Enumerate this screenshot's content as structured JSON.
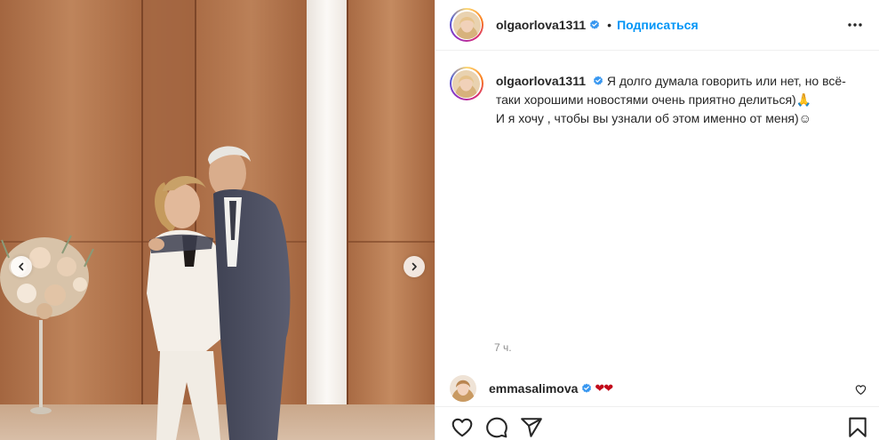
{
  "post": {
    "author": {
      "username": "olgaorlova1311",
      "verified": true,
      "avatar_icon": "profile-photo"
    },
    "header": {
      "separator": "•",
      "follow_label": "Подписаться",
      "more_icon": "more-horizontal-icon"
    },
    "caption": {
      "username": "olgaorlova1311",
      "text": "Я долго думала говорить или нет, но всё-таки хорошими новостями очень приятно делиться)🙏\nИ я хочу , чтобы вы узнали об этом именно от меня)☺"
    },
    "timestamp": "7 ч.",
    "comments": [
      {
        "username": "emmasalimova",
        "verified": true,
        "text": "❤❤"
      }
    ],
    "actions": [
      "like-icon",
      "comment-icon",
      "share-icon",
      "save-icon"
    ],
    "carousel": {
      "prev_icon": "chevron-left-icon",
      "next_icon": "chevron-right-icon"
    }
  },
  "colors": {
    "accent": "#0095f6",
    "verified": "#3897f0",
    "text": "#262626",
    "muted": "#8e8e8e",
    "heart": "#c20a1a",
    "border": "#efefef"
  }
}
